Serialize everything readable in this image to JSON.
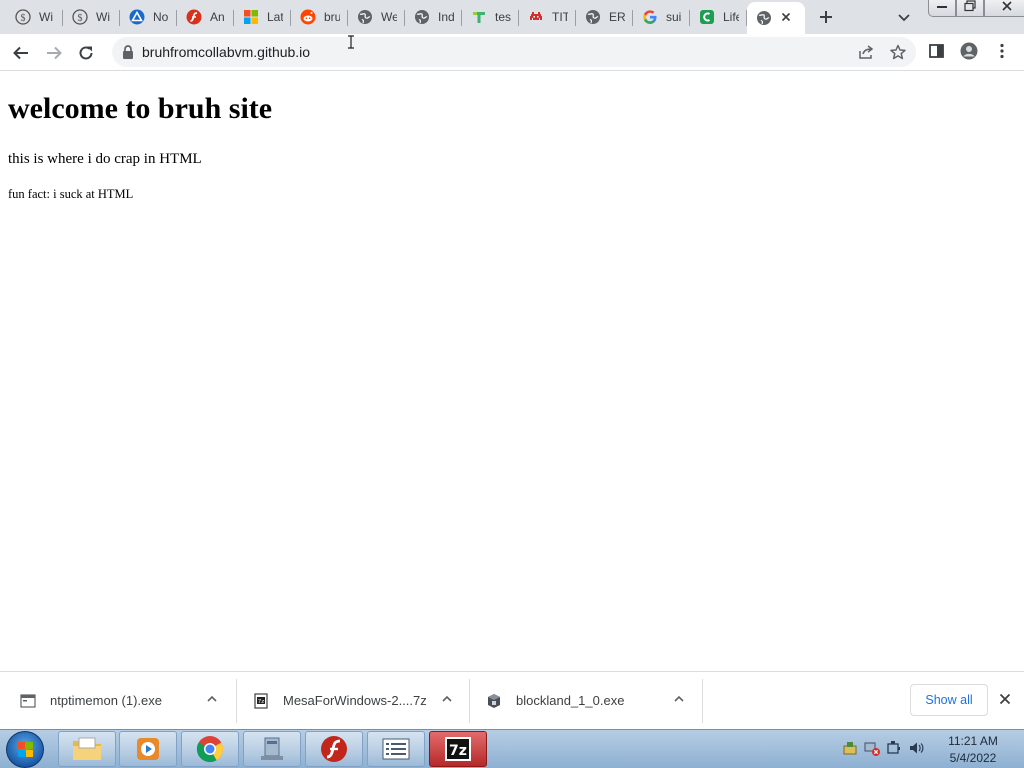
{
  "tabs": [
    {
      "title": "Wi",
      "icon": "wikipedia-icon"
    },
    {
      "title": "Wi",
      "icon": "wikipedia-icon"
    },
    {
      "title": "No",
      "icon": "triangle-app-icon"
    },
    {
      "title": "An",
      "icon": "flash-icon"
    },
    {
      "title": "Lat",
      "icon": "microsoft-icon"
    },
    {
      "title": "bru",
      "icon": "reddit-icon"
    },
    {
      "title": "We",
      "icon": "globe-icon"
    },
    {
      "title": "Ind",
      "icon": "globe-icon"
    },
    {
      "title": "tes",
      "icon": "t-logo-icon"
    },
    {
      "title": "TIT",
      "icon": "space-invader-icon"
    },
    {
      "title": "ERI",
      "icon": "globe-icon"
    },
    {
      "title": "sui",
      "icon": "google-icon"
    },
    {
      "title": "Life",
      "icon": "c-logo-icon"
    },
    {
      "title": "",
      "icon": "globe-icon",
      "active": true
    }
  ],
  "toolbar": {
    "url": "bruhfromcollabvm.github.io"
  },
  "page": {
    "heading": "welcome to bruh site",
    "paragraph": "this is where i do crap in HTML",
    "fun_fact": "fun fact: i suck at HTML"
  },
  "downloads": [
    {
      "name": "ntptimemon (1).exe",
      "icon": "exe-window-icon"
    },
    {
      "name": "MesaForWindows-2....7z",
      "icon": "7z-archive-icon"
    },
    {
      "name": "blockland_1_0.exe",
      "icon": "blockland-icon"
    }
  ],
  "shelf": {
    "show_all_label": "Show all"
  },
  "taskbar": {
    "apps": [
      "file-explorer-icon",
      "media-player-icon",
      "chrome-icon",
      "network-icon",
      "flash-player-icon",
      "notepad-icon",
      "7zip-icon"
    ],
    "time": "11:21 AM",
    "date": "5/4/2022"
  },
  "colors": {
    "tabstrip": "#dee1e6",
    "link_blue": "#1a73e8",
    "taskbar": "#a7c1dc"
  }
}
